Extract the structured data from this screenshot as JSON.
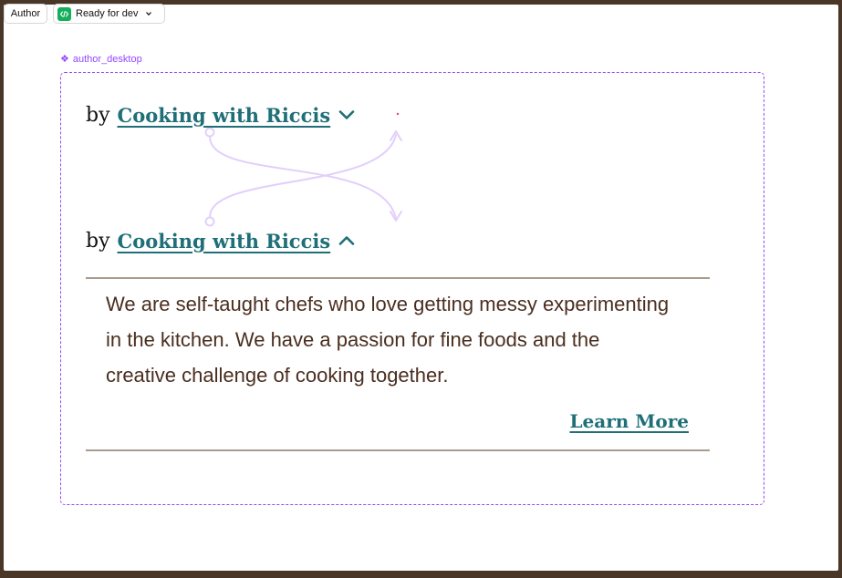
{
  "toolbar": {
    "component_label": "Author",
    "status_label": "Ready for dev",
    "status_icon": "code-icon",
    "status_color": "#14ae5c"
  },
  "frame": {
    "name": "author_desktop",
    "outline_color": "#9747ff"
  },
  "author": {
    "by_text": "by",
    "name": "Cooking with Riccis",
    "link_color": "#1f6f78"
  },
  "bio": {
    "text": "We are self-taught chefs who love getting messy experimenting in the kitchen. We have a passion for fine foods and the creative challenge of cooking together.",
    "text_color": "#4a2e1f"
  },
  "learn_more": {
    "label": "Learn More"
  },
  "prototype_color": "#e2cffb"
}
